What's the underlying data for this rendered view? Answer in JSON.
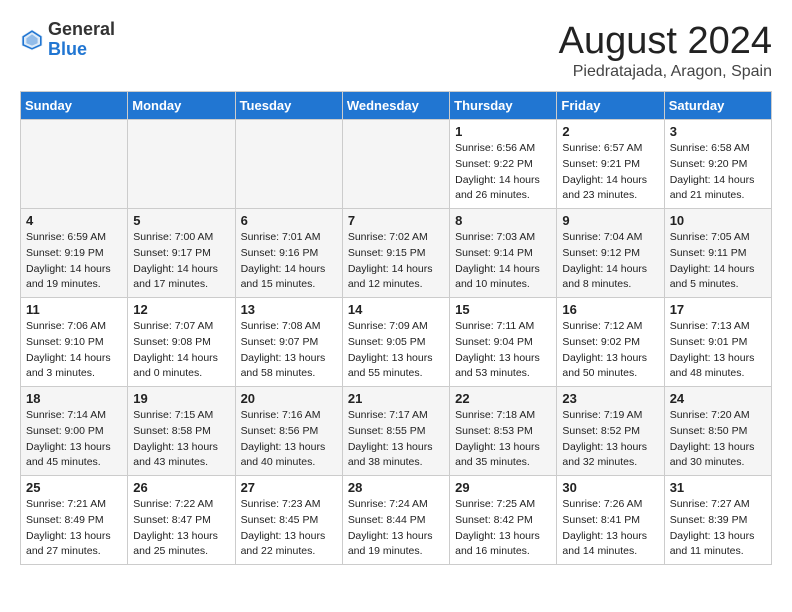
{
  "header": {
    "logo_general": "General",
    "logo_blue": "Blue",
    "month_title": "August 2024",
    "location": "Piedratajada, Aragon, Spain"
  },
  "weekdays": [
    "Sunday",
    "Monday",
    "Tuesday",
    "Wednesday",
    "Thursday",
    "Friday",
    "Saturday"
  ],
  "weeks": [
    [
      {
        "day": "",
        "empty": true
      },
      {
        "day": "",
        "empty": true
      },
      {
        "day": "",
        "empty": true
      },
      {
        "day": "",
        "empty": true
      },
      {
        "day": "1",
        "sunrise": "6:56 AM",
        "sunset": "9:22 PM",
        "daylight": "14 hours and 26 minutes."
      },
      {
        "day": "2",
        "sunrise": "6:57 AM",
        "sunset": "9:21 PM",
        "daylight": "14 hours and 23 minutes."
      },
      {
        "day": "3",
        "sunrise": "6:58 AM",
        "sunset": "9:20 PM",
        "daylight": "14 hours and 21 minutes."
      }
    ],
    [
      {
        "day": "4",
        "sunrise": "6:59 AM",
        "sunset": "9:19 PM",
        "daylight": "14 hours and 19 minutes."
      },
      {
        "day": "5",
        "sunrise": "7:00 AM",
        "sunset": "9:17 PM",
        "daylight": "14 hours and 17 minutes."
      },
      {
        "day": "6",
        "sunrise": "7:01 AM",
        "sunset": "9:16 PM",
        "daylight": "14 hours and 15 minutes."
      },
      {
        "day": "7",
        "sunrise": "7:02 AM",
        "sunset": "9:15 PM",
        "daylight": "14 hours and 12 minutes."
      },
      {
        "day": "8",
        "sunrise": "7:03 AM",
        "sunset": "9:14 PM",
        "daylight": "14 hours and 10 minutes."
      },
      {
        "day": "9",
        "sunrise": "7:04 AM",
        "sunset": "9:12 PM",
        "daylight": "14 hours and 8 minutes."
      },
      {
        "day": "10",
        "sunrise": "7:05 AM",
        "sunset": "9:11 PM",
        "daylight": "14 hours and 5 minutes."
      }
    ],
    [
      {
        "day": "11",
        "sunrise": "7:06 AM",
        "sunset": "9:10 PM",
        "daylight": "14 hours and 3 minutes."
      },
      {
        "day": "12",
        "sunrise": "7:07 AM",
        "sunset": "9:08 PM",
        "daylight": "14 hours and 0 minutes."
      },
      {
        "day": "13",
        "sunrise": "7:08 AM",
        "sunset": "9:07 PM",
        "daylight": "13 hours and 58 minutes."
      },
      {
        "day": "14",
        "sunrise": "7:09 AM",
        "sunset": "9:05 PM",
        "daylight": "13 hours and 55 minutes."
      },
      {
        "day": "15",
        "sunrise": "7:11 AM",
        "sunset": "9:04 PM",
        "daylight": "13 hours and 53 minutes."
      },
      {
        "day": "16",
        "sunrise": "7:12 AM",
        "sunset": "9:02 PM",
        "daylight": "13 hours and 50 minutes."
      },
      {
        "day": "17",
        "sunrise": "7:13 AM",
        "sunset": "9:01 PM",
        "daylight": "13 hours and 48 minutes."
      }
    ],
    [
      {
        "day": "18",
        "sunrise": "7:14 AM",
        "sunset": "9:00 PM",
        "daylight": "13 hours and 45 minutes."
      },
      {
        "day": "19",
        "sunrise": "7:15 AM",
        "sunset": "8:58 PM",
        "daylight": "13 hours and 43 minutes."
      },
      {
        "day": "20",
        "sunrise": "7:16 AM",
        "sunset": "8:56 PM",
        "daylight": "13 hours and 40 minutes."
      },
      {
        "day": "21",
        "sunrise": "7:17 AM",
        "sunset": "8:55 PM",
        "daylight": "13 hours and 38 minutes."
      },
      {
        "day": "22",
        "sunrise": "7:18 AM",
        "sunset": "8:53 PM",
        "daylight": "13 hours and 35 minutes."
      },
      {
        "day": "23",
        "sunrise": "7:19 AM",
        "sunset": "8:52 PM",
        "daylight": "13 hours and 32 minutes."
      },
      {
        "day": "24",
        "sunrise": "7:20 AM",
        "sunset": "8:50 PM",
        "daylight": "13 hours and 30 minutes."
      }
    ],
    [
      {
        "day": "25",
        "sunrise": "7:21 AM",
        "sunset": "8:49 PM",
        "daylight": "13 hours and 27 minutes."
      },
      {
        "day": "26",
        "sunrise": "7:22 AM",
        "sunset": "8:47 PM",
        "daylight": "13 hours and 25 minutes."
      },
      {
        "day": "27",
        "sunrise": "7:23 AM",
        "sunset": "8:45 PM",
        "daylight": "13 hours and 22 minutes."
      },
      {
        "day": "28",
        "sunrise": "7:24 AM",
        "sunset": "8:44 PM",
        "daylight": "13 hours and 19 minutes."
      },
      {
        "day": "29",
        "sunrise": "7:25 AM",
        "sunset": "8:42 PM",
        "daylight": "13 hours and 16 minutes."
      },
      {
        "day": "30",
        "sunrise": "7:26 AM",
        "sunset": "8:41 PM",
        "daylight": "13 hours and 14 minutes."
      },
      {
        "day": "31",
        "sunrise": "7:27 AM",
        "sunset": "8:39 PM",
        "daylight": "13 hours and 11 minutes."
      }
    ]
  ]
}
